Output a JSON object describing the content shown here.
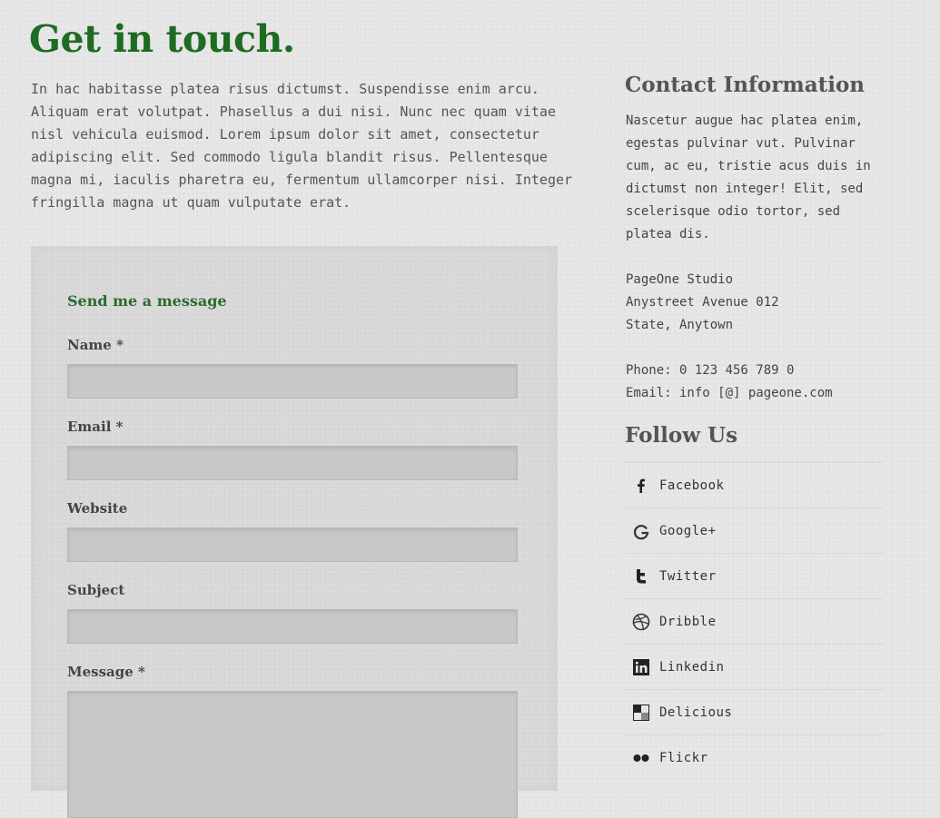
{
  "page": {
    "title": "Get in touch.",
    "intro": "In hac habitasse platea risus dictumst. Suspendisse enim arcu. Aliquam erat volutpat. Phasellus a dui nisi. Nunc nec quam vitae nisl vehicula euismod. Lorem ipsum dolor sit amet, consectetur adipiscing elit. Sed commodo ligula blandit risus. Pellentesque magna mi, iaculis pharetra eu, fermentum ullamcorper nisi. Integer fringilla magna ut quam vulputate erat."
  },
  "form": {
    "heading": "Send me a message",
    "fields": [
      {
        "label": "Name *",
        "value": ""
      },
      {
        "label": "Email *",
        "value": ""
      },
      {
        "label": "Website",
        "value": ""
      },
      {
        "label": "Subject",
        "value": ""
      },
      {
        "label": "Message *",
        "value": ""
      }
    ]
  },
  "sidebar": {
    "contact_heading": "Contact Information",
    "contact_text": "Nascetur augue hac platea enim, egestas pulvinar vut. Pulvinar cum, ac eu, tristie acus duis in dictumst non integer! Elit, sed scelerisque odio tortor, sed platea dis.",
    "address": [
      "PageOne Studio",
      "Anystreet Avenue 012",
      "State, Anytown"
    ],
    "phone": "Phone: 0 123 456 789 0",
    "email": "Email: info [@] pageone.com",
    "follow_heading": "Follow Us",
    "social": [
      {
        "label": "Facebook",
        "icon": "facebook-icon"
      },
      {
        "label": "Google+",
        "icon": "google-plus-icon"
      },
      {
        "label": "Twitter",
        "icon": "twitter-icon"
      },
      {
        "label": "Dribble",
        "icon": "dribbble-icon"
      },
      {
        "label": "Linkedin",
        "icon": "linkedin-icon"
      },
      {
        "label": "Delicious",
        "icon": "delicious-icon"
      },
      {
        "label": "Flickr",
        "icon": "flickr-icon"
      }
    ]
  },
  "colors": {
    "accent": "#1e6b22",
    "text": "#444444",
    "field_bg": "#c8c8c8"
  }
}
